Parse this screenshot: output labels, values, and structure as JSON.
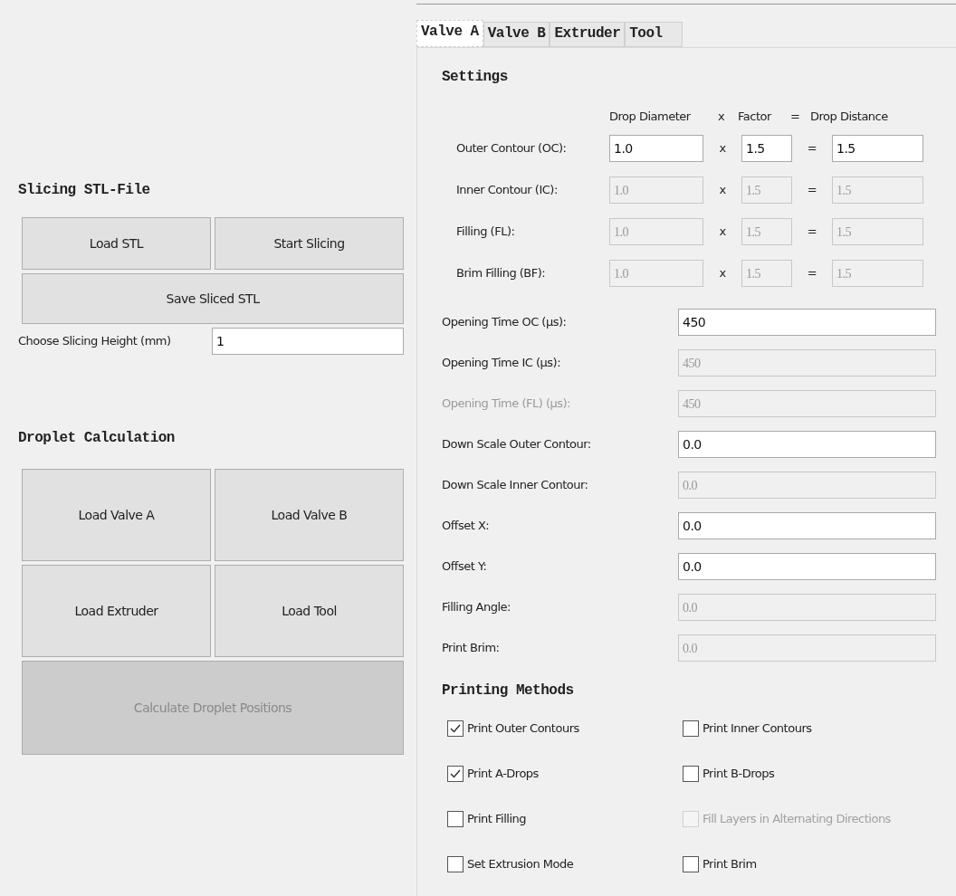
{
  "left": {
    "slicing": {
      "title": "Slicing STL-File",
      "buttons": [
        {
          "label": "Load STL",
          "disabled": false
        },
        {
          "label": "Start Slicing",
          "disabled": false
        }
      ],
      "save_button": {
        "label": "Save Sliced STL",
        "disabled": false
      },
      "height_label": "Choose Slicing Height (mm)",
      "height_value": "1"
    },
    "droplet": {
      "title": "Droplet Calculation",
      "buttons": [
        {
          "label": "Load Valve A",
          "disabled": false
        },
        {
          "label": "Load Valve B",
          "disabled": false
        },
        {
          "label": "Load Extruder",
          "disabled": false
        },
        {
          "label": "Load Tool",
          "disabled": false
        }
      ],
      "calculate_button": {
        "label": "Calculate Droplet Positions",
        "disabled": true
      }
    }
  },
  "tabs": [
    {
      "label": "Valve A",
      "selected": true
    },
    {
      "label": "Valve B",
      "selected": false
    },
    {
      "label": "Extruder",
      "selected": false
    },
    {
      "label": "Tool",
      "selected": false
    }
  ],
  "settings": {
    "title": "Settings",
    "headers": [
      "Drop Diameter",
      "x",
      "Factor",
      "=",
      "Drop Distance"
    ],
    "drop_rows": [
      {
        "label": "Outer Contour (OC):",
        "diameter": "1.0",
        "times": "x",
        "factor": "1.5",
        "equals": "=",
        "distance": "1.5",
        "disabled": false
      },
      {
        "label": "Inner Contour (IC):",
        "diameter": "1.0",
        "times": "x",
        "factor": "1.5",
        "equals": "=",
        "distance": "1.5",
        "disabled": true
      },
      {
        "label": "Filling (FL):",
        "diameter": "1.0",
        "times": "x",
        "factor": "1.5",
        "equals": "=",
        "distance": "1.5",
        "disabled": true
      },
      {
        "label": "Brim Filling (BF):",
        "diameter": "1.0",
        "times": "x",
        "factor": "1.5",
        "equals": "=",
        "distance": "1.5",
        "disabled": true
      }
    ],
    "fields": [
      {
        "label": "Opening Time OC (µs):",
        "value": "450",
        "disabled": false,
        "label_disabled": false
      },
      {
        "label": "Opening Time IC (µs):",
        "value": "450",
        "disabled": true,
        "label_disabled": false
      },
      {
        "label": "Opening Time (FL) (µs):",
        "value": "450",
        "disabled": true,
        "label_disabled": true
      },
      {
        "label": "Down Scale Outer Contour:",
        "value": "0.0",
        "disabled": false,
        "label_disabled": false
      },
      {
        "label": "Down Scale Inner Contour:",
        "value": "0.0",
        "disabled": true,
        "label_disabled": false
      },
      {
        "label": "Offset X:",
        "value": "0.0",
        "disabled": false,
        "label_disabled": false
      },
      {
        "label": "Offset Y:",
        "value": "0.0",
        "disabled": false,
        "label_disabled": false
      },
      {
        "label": "Filling Angle:",
        "value": "0.0",
        "disabled": true,
        "label_disabled": false
      },
      {
        "label": "Print Brim:",
        "value": "0.0",
        "disabled": true,
        "label_disabled": false
      }
    ]
  },
  "printing_methods": {
    "title": "Printing Methods",
    "options": [
      {
        "label": "Print Outer Contours",
        "checked": true,
        "disabled": false
      },
      {
        "label": "Print Inner Contours",
        "checked": false,
        "disabled": false
      },
      {
        "label": "Print A-Drops",
        "checked": true,
        "disabled": false
      },
      {
        "label": "Print B-Drops",
        "checked": false,
        "disabled": false
      },
      {
        "label": "Print Filling",
        "checked": false,
        "disabled": false
      },
      {
        "label": "Fill Layers in Alternating Directions",
        "checked": false,
        "disabled": true
      },
      {
        "label": "Set Extrusion Mode",
        "checked": false,
        "disabled": false
      },
      {
        "label": "Print Brim",
        "checked": false,
        "disabled": false
      }
    ]
  }
}
